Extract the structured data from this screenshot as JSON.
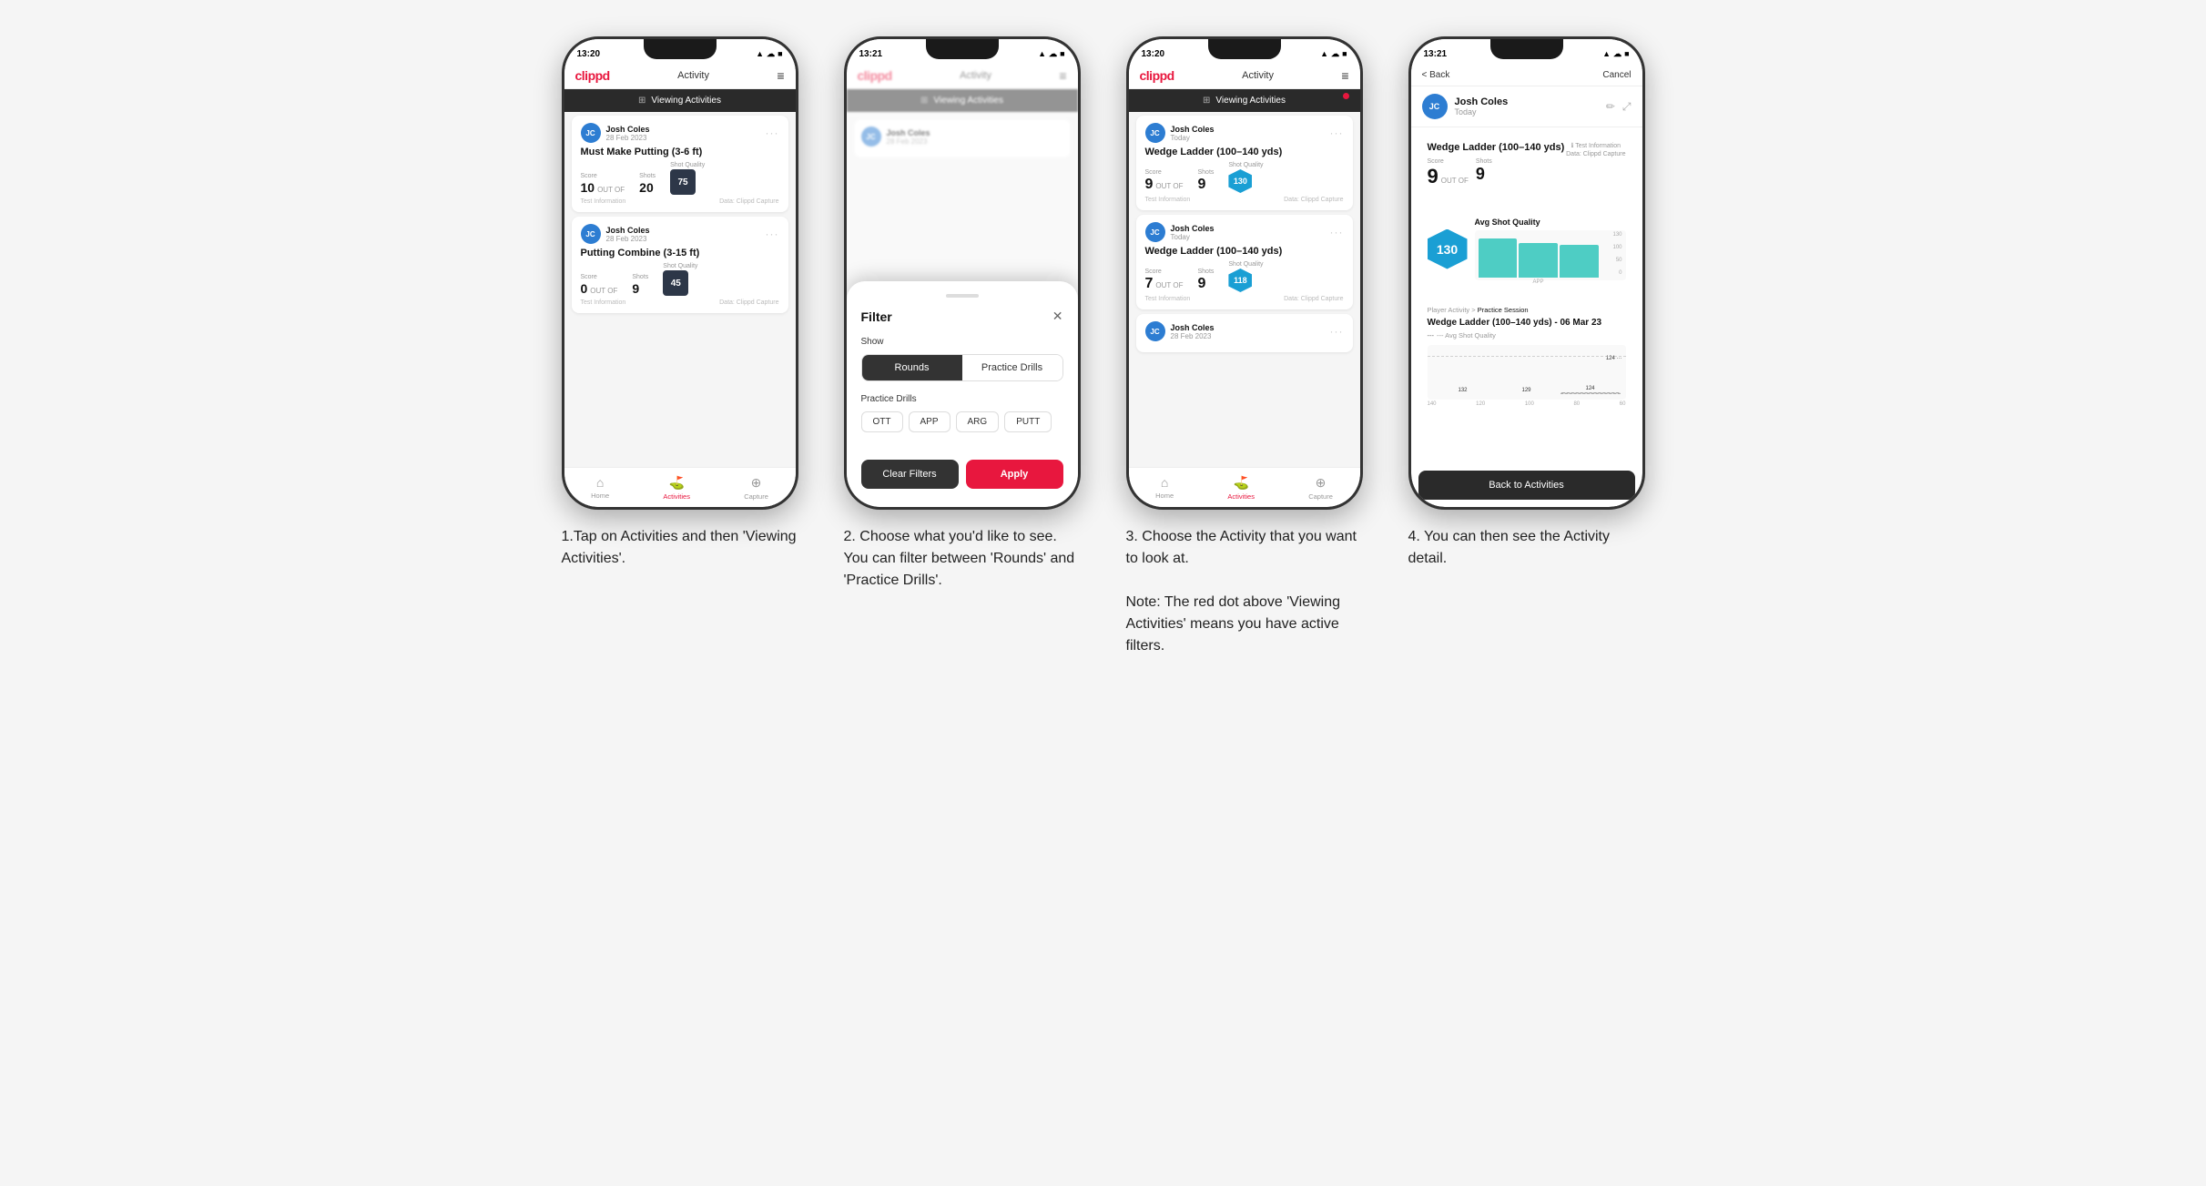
{
  "phones": [
    {
      "id": "phone1",
      "statusBar": {
        "time": "13:20",
        "icons": "▲ ☁ 🔋"
      },
      "header": {
        "logo": "clippd",
        "title": "Activity",
        "menu": "≡"
      },
      "banner": {
        "text": "Viewing Activities",
        "hasDot": false
      },
      "cards": [
        {
          "userName": "Josh Coles",
          "userDate": "28 Feb 2023",
          "title": "Must Make Putting (3-6 ft)",
          "scoreLabel": "Score",
          "score": "10",
          "shotsLabel": "Shots",
          "shots": "20",
          "sqLabel": "Shot Quality",
          "sq": "75",
          "sqType": "badge",
          "footer1": "Test Information",
          "footer2": "Data: Clippd Capture"
        },
        {
          "userName": "Josh Coles",
          "userDate": "28 Feb 2023",
          "title": "Putting Combine (3-15 ft)",
          "scoreLabel": "Score",
          "score": "0",
          "shotsLabel": "Shots",
          "shots": "9",
          "sqLabel": "Shot Quality",
          "sq": "45",
          "sqType": "badge",
          "footer1": "Test Information",
          "footer2": "Data: Clippd Capture"
        }
      ],
      "nav": [
        {
          "icon": "⌂",
          "label": "Home",
          "active": false
        },
        {
          "icon": "♟",
          "label": "Activities",
          "active": true
        },
        {
          "icon": "⊕",
          "label": "Capture",
          "active": false
        }
      ],
      "caption": "1.Tap on Activities and then 'Viewing Activities'."
    },
    {
      "id": "phone2",
      "statusBar": {
        "time": "13:21",
        "icons": "▲ ☁ 🔋"
      },
      "header": {
        "logo": "clippd",
        "title": "Activity",
        "menu": "≡"
      },
      "banner": {
        "text": "Viewing Activities",
        "hasDot": false
      },
      "modal": {
        "title": "Filter",
        "showLabel": "Show",
        "toggles": [
          "Rounds",
          "Practice Drills"
        ],
        "activeToggle": 0,
        "drillsLabel": "Practice Drills",
        "drillTags": [
          "OTT",
          "APP",
          "ARG",
          "PUTT"
        ],
        "clearLabel": "Clear Filters",
        "applyLabel": "Apply"
      },
      "caption": "2. Choose what you'd like to see. You can filter between 'Rounds' and 'Practice Drills'."
    },
    {
      "id": "phone3",
      "statusBar": {
        "time": "13:20",
        "icons": "▲ ☁ 🔋"
      },
      "header": {
        "logo": "clippd",
        "title": "Activity",
        "menu": "≡"
      },
      "banner": {
        "text": "Viewing Activities",
        "hasDot": true
      },
      "cards": [
        {
          "userName": "Josh Coles",
          "userDate": "Today",
          "title": "Wedge Ladder (100–140 yds)",
          "scoreLabel": "Score",
          "score": "9",
          "shotsLabel": "Shots",
          "shots": "9",
          "sqLabel": "Shot Quality",
          "sq": "130",
          "sqType": "hex",
          "footer1": "Test Information",
          "footer2": "Data: Clippd Capture"
        },
        {
          "userName": "Josh Coles",
          "userDate": "Today",
          "title": "Wedge Ladder (100–140 yds)",
          "scoreLabel": "Score",
          "score": "7",
          "shotsLabel": "Shots",
          "shots": "9",
          "sqLabel": "Shot Quality",
          "sq": "118",
          "sqType": "hex",
          "footer1": "Test Information",
          "footer2": "Data: Clippd Capture"
        },
        {
          "userName": "Josh Coles",
          "userDate": "28 Feb 2023",
          "title": "",
          "scoreLabel": "",
          "score": "",
          "shotsLabel": "",
          "shots": "",
          "sqLabel": "",
          "sq": "",
          "sqType": "badge",
          "footer1": "",
          "footer2": ""
        }
      ],
      "nav": [
        {
          "icon": "⌂",
          "label": "Home",
          "active": false
        },
        {
          "icon": "♟",
          "label": "Activities",
          "active": true
        },
        {
          "icon": "⊕",
          "label": "Capture",
          "active": false
        }
      ],
      "caption": "3. Choose the Activity that you want to look at.\n\nNote: The red dot above 'Viewing Activities' means you have active filters."
    },
    {
      "id": "phone4",
      "statusBar": {
        "time": "13:21",
        "icons": "▲ ☁ 🔋"
      },
      "backLabel": "< Back",
      "cancelLabel": "Cancel",
      "user": {
        "name": "Josh Coles",
        "date": "Today"
      },
      "activity": {
        "titleLeft": "Wedge Ladder (100–140 yds)",
        "scoreLabel": "Score",
        "score": "9",
        "outOf": "OUT OF",
        "shots": "9",
        "shotsLabel": "Shots",
        "sqLabel": "Avg Shot Quality",
        "sq": "130",
        "chartData": [
          132,
          129,
          124
        ],
        "chartYLabels": [
          "130",
          "100",
          "50",
          "0"
        ],
        "chartXLabel": "APP",
        "sessionType": "Player Activity > Practice Session",
        "sessionTitle": "Wedge Ladder (100–140 yds) - 06 Mar 23",
        "sessionSubLabel": "--- Avg Shot Quality"
      },
      "backToActivities": "Back to Activities",
      "caption": "4. You can then see the Activity detail."
    }
  ]
}
